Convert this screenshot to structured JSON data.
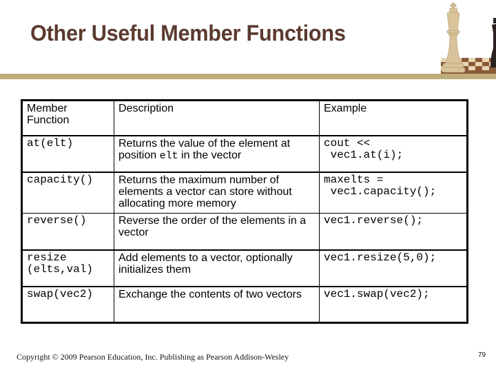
{
  "slide": {
    "title": "Other Useful Member Functions",
    "colors": {
      "title": "#5b3a2f",
      "accent_bar": "#bfae7a"
    }
  },
  "table": {
    "headers": [
      "Member Function",
      "Description",
      "Example"
    ],
    "rows": [
      {
        "function": "at(elt)",
        "description_pre": "Returns the value of the element at position ",
        "description_code": "elt",
        "description_post": " in the vector",
        "example": "cout <<\n vec1.at(i);"
      },
      {
        "function": "capacity()",
        "description": "Returns the maximum number of elements a vector can store without allocating more memory",
        "example": "maxelts =\n vec1.capacity();"
      },
      {
        "function": "reverse()",
        "description": "Reverse the order of the elements in a vector",
        "example": "vec1.reverse();"
      },
      {
        "function": "resize\n(elts,val)",
        "description": "Add elements to a vector, optionally initializes them",
        "example": "vec1.resize(5,0);"
      },
      {
        "function": "swap(vec2)",
        "description": "Exchange the contents of two vectors",
        "example": "vec1.swap(vec2);"
      }
    ]
  },
  "footer": {
    "copyright": "Copyright © 2009 Pearson Education, Inc. Publishing as Pearson Addison-Wesley",
    "page_number": "79"
  },
  "icons": {
    "decor": "chess-king-icon"
  }
}
